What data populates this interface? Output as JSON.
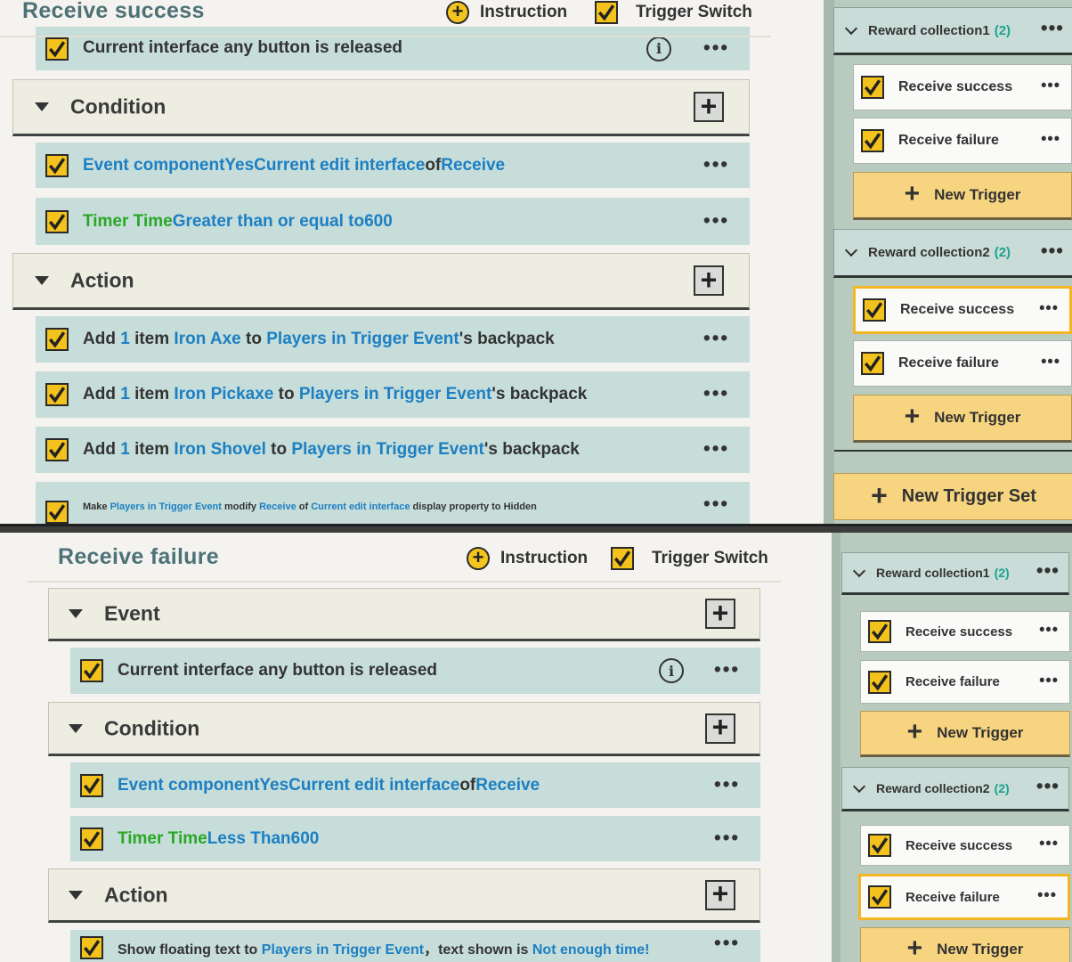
{
  "check_icon": "checkmark-icon",
  "top_panel": {
    "title": "Receive success",
    "instruction_label": "Instruction",
    "trigger_switch_label": "Trigger Switch",
    "event_row": "Current interface any button is released",
    "condition_label": "Condition",
    "conditions": [
      [
        "Event componentYesCurrent edit interface",
        "of",
        "Receive"
      ],
      [
        "Timer Time",
        "Greater than or equal to",
        "600"
      ]
    ],
    "action_label": "Action",
    "actions": [
      {
        "a": "Add ",
        "n": "1",
        "b": " item ",
        "item": "Iron Axe",
        "c": " to ",
        "target": "Players in Trigger Event",
        "d": "'s backpack"
      },
      {
        "a": "Add ",
        "n": "1",
        "b": " item ",
        "item": "Iron Pickaxe",
        "c": " to ",
        "target": "Players in Trigger Event",
        "d": "'s backpack"
      },
      {
        "a": "Add ",
        "n": "1",
        "b": " item ",
        "item": "Iron Shovel",
        "c": " to ",
        "target": "Players in Trigger Event",
        "d": "'s backpack"
      }
    ],
    "last_action": {
      "a": "Make ",
      "target": "Players in Trigger Event",
      "b": " modify ",
      "comp": "Receive",
      "c": " of ",
      "iface": "Current edit interface",
      "d": " display property to Hidden"
    }
  },
  "bottom_panel": {
    "title": "Receive failure",
    "instruction_label": "Instruction",
    "trigger_switch_label": "Trigger Switch",
    "event_label": "Event",
    "event_row": "Current interface any button is released",
    "condition_label": "Condition",
    "conditions": [
      [
        "Event componentYesCurrent edit interface",
        "of",
        "Receive"
      ],
      [
        "Timer Time",
        "Less Than",
        "600"
      ]
    ],
    "action_label": "Action",
    "action": {
      "a": "Show floating text to ",
      "target": "Players in Trigger Event",
      "b": "，text shown is ",
      "msg": "Not enough time!"
    }
  },
  "sidebar": {
    "group1": {
      "name": "Reward collection1",
      "count": "(2)"
    },
    "group2": {
      "name": "Reward collection2",
      "count": "(2)"
    },
    "trigger_success": "Receive success",
    "trigger_failure": "Receive failure",
    "new_trigger": "New Trigger",
    "new_trigger_set": "New Trigger Set",
    "more": "•••"
  }
}
